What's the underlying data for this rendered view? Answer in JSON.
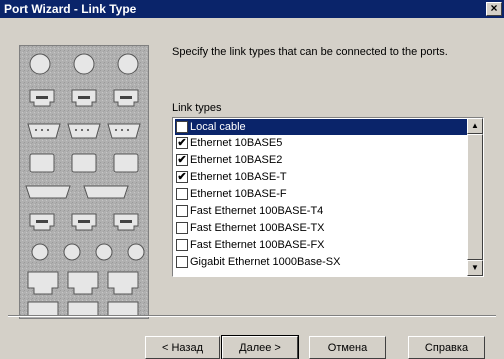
{
  "window": {
    "title": "Port Wizard - Link Type",
    "close_glyph": "×"
  },
  "content": {
    "instruction": "Specify the link types that can be connected to the ports.",
    "group_label": "Link types"
  },
  "link_types": [
    {
      "label": "Local cable",
      "checked": false,
      "selected": true
    },
    {
      "label": "Ethernet 10BASE5",
      "checked": true,
      "selected": false
    },
    {
      "label": "Ethernet 10BASE2",
      "checked": true,
      "selected": false
    },
    {
      "label": "Ethernet 10BASE-T",
      "checked": true,
      "selected": false
    },
    {
      "label": "Ethernet 10BASE-F",
      "checked": false,
      "selected": false
    },
    {
      "label": "Fast Ethernet 100BASE-T4",
      "checked": false,
      "selected": false
    },
    {
      "label": "Fast Ethernet 100BASE-TX",
      "checked": false,
      "selected": false
    },
    {
      "label": "Fast Ethernet 100BASE-FX",
      "checked": false,
      "selected": false
    },
    {
      "label": "Gigabit Ethernet 1000Base-SX",
      "checked": false,
      "selected": false
    }
  ],
  "buttons": {
    "back": "< Назад",
    "next": "Далее >",
    "cancel": "Отмена",
    "help": "Справка"
  },
  "icons": {
    "decorative_image": "network-ports-image",
    "checkmark": "✔",
    "scroll_up": "▲",
    "scroll_down": "▼"
  },
  "colors": {
    "titlebar": "#0a246a",
    "dialog_bg": "#d4d0c8",
    "selection": "#0a246a"
  }
}
